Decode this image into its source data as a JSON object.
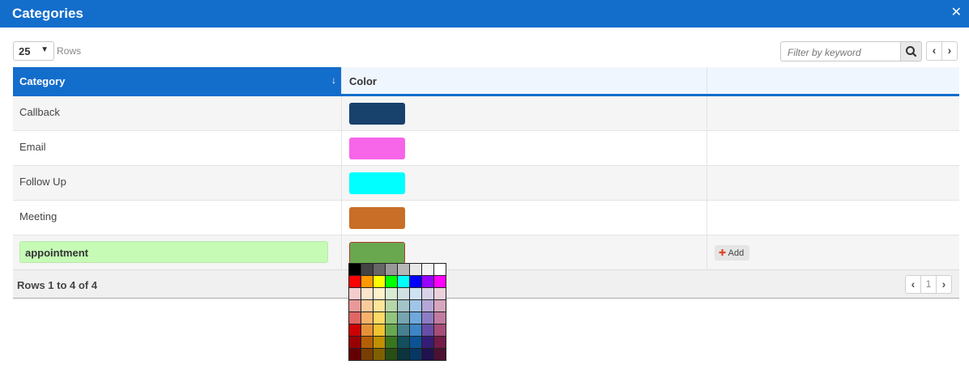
{
  "titlebar": {
    "title": "Categories",
    "close_glyph": "✕"
  },
  "toolbar": {
    "rows_value": "25",
    "rows_label": "Rows",
    "filter_placeholder": "Filter by keyword",
    "search_icon": "search-icon",
    "prev_glyph": "‹",
    "next_glyph": "›"
  },
  "columns": {
    "category": "Category",
    "color": "Color",
    "sort_glyph": "↓"
  },
  "rows": [
    {
      "category": "Callback",
      "color": "#18416b"
    },
    {
      "category": "Email",
      "color": "#f765e8"
    },
    {
      "category": "Follow Up",
      "color": "#00ffff"
    },
    {
      "category": "Meeting",
      "color": "#c96e27"
    }
  ],
  "edit_row": {
    "category": "appointment",
    "color": "#6aa84f",
    "add_label": "Add",
    "add_glyph": "✚"
  },
  "footer": {
    "status": "Rows 1 to 4 of 4",
    "page": "1",
    "prev_glyph": "‹",
    "next_glyph": "›"
  },
  "palette": [
    [
      "#000000",
      "#434343",
      "#666666",
      "#999999",
      "#b7b7b7",
      "#e8e8e8",
      "#f3f3f3",
      "#ffffff"
    ],
    [
      "#ff0000",
      "#ff9900",
      "#ffff00",
      "#00ff00",
      "#00ffff",
      "#0000ff",
      "#9900ff",
      "#ff00ff"
    ],
    [
      "#f4cccc",
      "#fce5cd",
      "#fff2cc",
      "#d9ead3",
      "#d0e0e3",
      "#cfe2f3",
      "#d9d2e9",
      "#ead1dc"
    ],
    [
      "#ea9999",
      "#f9cb9c",
      "#ffe599",
      "#b6d7a8",
      "#a2c4c9",
      "#9fc5e8",
      "#b4a7d6",
      "#d5a6bd"
    ],
    [
      "#e06666",
      "#f6b26b",
      "#ffd966",
      "#93c47d",
      "#76a5af",
      "#6fa8dc",
      "#8e7cc3",
      "#c27ba0"
    ],
    [
      "#cc0000",
      "#e69138",
      "#f1c232",
      "#6aa84f",
      "#45818e",
      "#3d85c6",
      "#674ea7",
      "#a64d79"
    ],
    [
      "#990000",
      "#b45f06",
      "#bf9000",
      "#38761d",
      "#134f5c",
      "#0b5394",
      "#351c75",
      "#741b47"
    ],
    [
      "#660000",
      "#783f04",
      "#7f6000",
      "#274e13",
      "#0c343d",
      "#073763",
      "#20124d",
      "#4c1130"
    ]
  ]
}
